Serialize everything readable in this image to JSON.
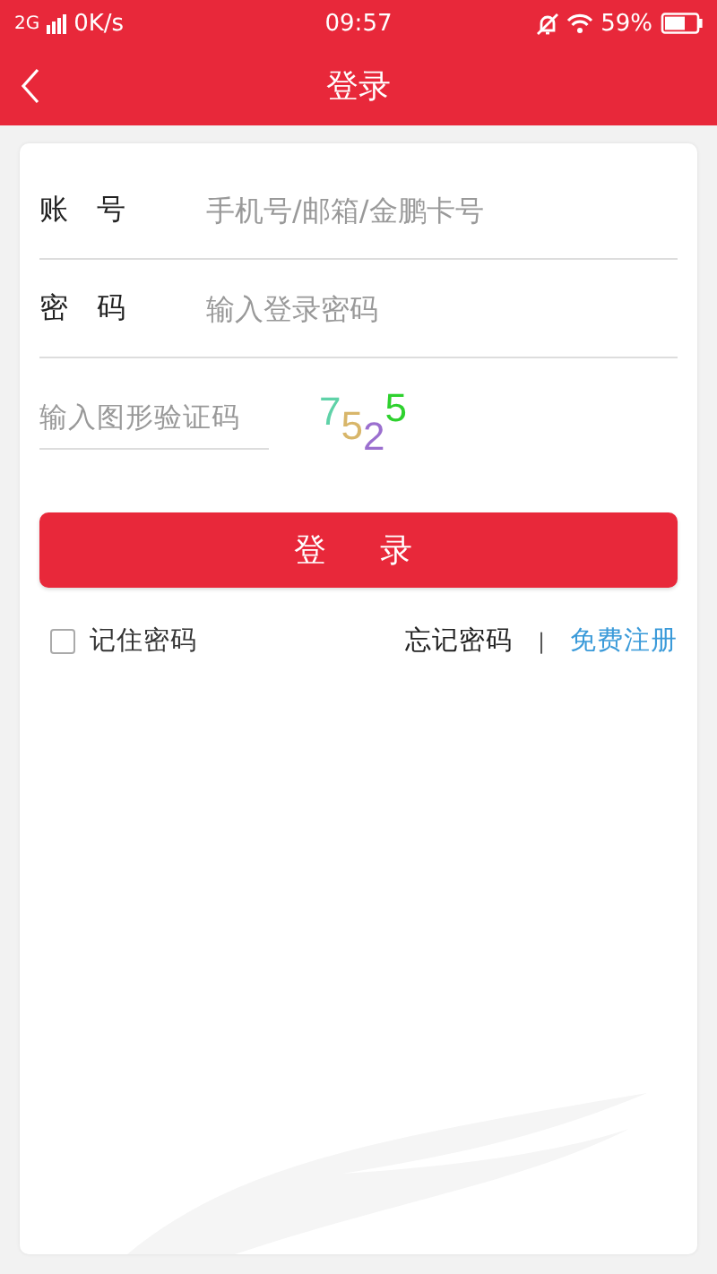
{
  "status_bar": {
    "network": "2G",
    "speed": "0K/s",
    "time": "09:57",
    "battery": "59%"
  },
  "header": {
    "title": "登录"
  },
  "form": {
    "fields": [
      {
        "label": "账号",
        "placeholder": "手机号/邮箱/金鹏卡号"
      },
      {
        "label": "密码",
        "placeholder": "输入登录密码"
      }
    ],
    "captcha_field": {
      "placeholder": "输入图形验证码"
    },
    "captcha": [
      {
        "char": "7",
        "color": "#5fd2a8"
      },
      {
        "char": "5",
        "color": "#d8b66a"
      },
      {
        "char": "2",
        "color": "#9b6fcf"
      },
      {
        "char": "5",
        "color": "#2ed12e"
      }
    ],
    "submit": "登录",
    "remember": {
      "label": "记住密码",
      "checked": false
    },
    "forgot": "忘记密码",
    "separator": "|",
    "register": "免费注册"
  }
}
